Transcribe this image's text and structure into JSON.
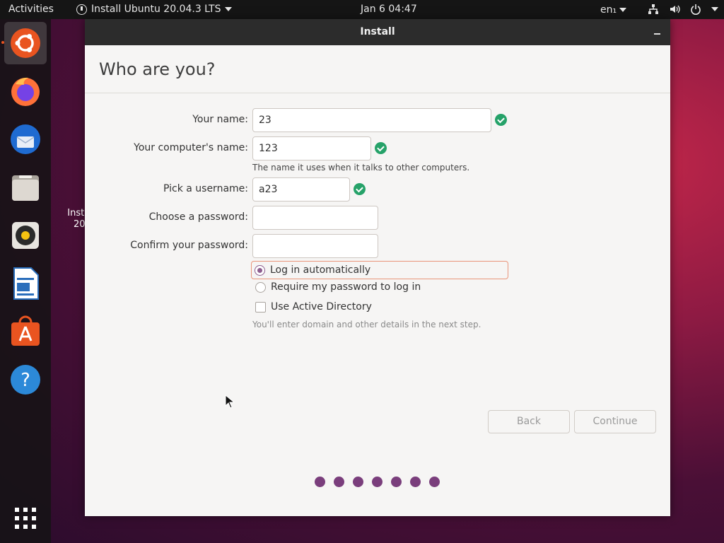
{
  "topbar": {
    "activities": "Activities",
    "app_menu": "Install Ubuntu 20.04.3 LTS",
    "clock": "Jan 6  04:47",
    "lang": "en₁"
  },
  "desktop": {
    "icon_label_line1": "Inst",
    "icon_label_line2": "20"
  },
  "window": {
    "title": "Install",
    "heading": "Who are you?"
  },
  "form": {
    "your_name_label": "Your name:",
    "your_name_value": "23",
    "computer_name_label": "Your computer's name:",
    "computer_name_value": "123",
    "computer_name_hint": "The name it uses when it talks to other computers.",
    "username_label": "Pick a username:",
    "username_value": "a23",
    "password_label": "Choose a password:",
    "password_value": "",
    "confirm_label": "Confirm your password:",
    "confirm_value": "",
    "login_auto": "Log in automatically",
    "login_require": "Require my password to log in",
    "active_directory": "Use Active Directory",
    "ad_hint": "You'll enter domain and other details in the next step."
  },
  "buttons": {
    "back": "Back",
    "continue": "Continue"
  },
  "progress": {
    "steps": 7
  },
  "colors": {
    "accent": "#e95420",
    "check": "#26a269",
    "dot": "#7a3e7c"
  }
}
